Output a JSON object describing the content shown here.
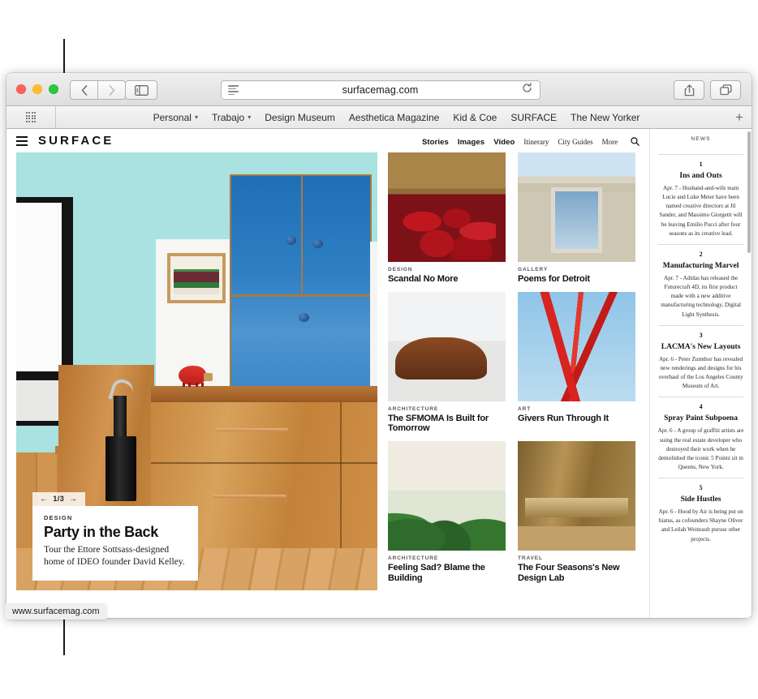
{
  "browser": {
    "window_controls": [
      "close",
      "minimize",
      "maximize"
    ],
    "back_label": "‹",
    "forward_label": "›",
    "sidebar_icon": "sidebar-icon",
    "reader_icon": "reader-view-icon",
    "url": "surfacemag.com",
    "reload_icon": "reload-icon",
    "share_icon": "share-icon",
    "tabs_icon": "show-all-tabs-icon",
    "add_bookmark_label": "+",
    "apps_icon": "show-favorites-grid-icon",
    "status_url": "www.surfacemag.com",
    "bookmarks": [
      {
        "label": "Personal",
        "has_menu": true
      },
      {
        "label": "Trabajo",
        "has_menu": true
      },
      {
        "label": "Design Museum",
        "has_menu": false
      },
      {
        "label": "Aesthetica Magazine",
        "has_menu": false
      },
      {
        "label": "Kid & Coe",
        "has_menu": false
      },
      {
        "label": "SURFACE",
        "has_menu": false
      },
      {
        "label": "The New Yorker",
        "has_menu": false
      }
    ]
  },
  "site": {
    "menu_icon": "hamburger-menu-icon",
    "brand": "SURFACE",
    "search_icon": "search-icon",
    "nav_primary": [
      "Stories",
      "Images",
      "Video"
    ],
    "nav_secondary": [
      "Itinerary",
      "City Guides",
      "More"
    ]
  },
  "hero": {
    "pager_prev": "←",
    "pager_label": "1/3",
    "pager_next": "→",
    "kicker": "DESIGN",
    "title": "Party in the Back",
    "description": "Tour the Ettore Sottsass-designed home of IDEO founder David Kelley."
  },
  "grid": {
    "cards": [
      {
        "kicker": "DESIGN",
        "title": "Scandal No More",
        "art": "t-theater"
      },
      {
        "kicker": "GALLERY",
        "title": "Poems for Detroit",
        "art": "t-gallery"
      },
      {
        "kicker": "ARCHITECTURE",
        "title": "The SFMOMA Is Built for Tomorrow",
        "art": "t-sfmoma"
      },
      {
        "kicker": "ART",
        "title": "Givers Run Through It",
        "art": "t-art"
      },
      {
        "kicker": "ARCHITECTURE",
        "title": "Feeling Sad? Blame the Building",
        "art": "t-plants"
      },
      {
        "kicker": "TRAVEL",
        "title": "The Four Seasons's New Design Lab",
        "art": "t-travel"
      }
    ]
  },
  "news": {
    "heading": "NEWS",
    "items": [
      {
        "number": "1",
        "title": "Ins and Outs",
        "body": "Apr. 7 - Husband-and-wife team Lucie and Luke Meier have been named creative directors at Jil Sander, and Massimo Giorgetti will be leaving Emilio Pucci after four seasons as its creative lead."
      },
      {
        "number": "2",
        "title": "Manufacturing Marvel",
        "body": "Apr. 7 - Adidas has released the Futurecraft 4D, its first product made with a new additive manufacturing technology, Digital Light Synthesis."
      },
      {
        "number": "3",
        "title": "LACMA's New Layouts",
        "body": "Apr. 6 - Peter Zumthor has revealed new renderings and designs for his overhaul of the Los Angeles County Museum of Art."
      },
      {
        "number": "4",
        "title": "Spray Paint Subpoena",
        "body": "Apr. 6 - A group of graffiti artists are suing the real estate developer who destroyed their work when he demolished the iconic 5 Pointz sit in Queens, New York."
      },
      {
        "number": "5",
        "title": "Side Hustles",
        "body": "Apr. 6 - Hood by Air is being put on hiatus, as cofounders Shayne Oliver and Leilah Weinraub pursue other projects."
      }
    ]
  },
  "colors": {
    "hero_wall": "#a9e2e0",
    "cabinet_blue": "#2f7fc4",
    "accent_red": "#d8231f"
  }
}
